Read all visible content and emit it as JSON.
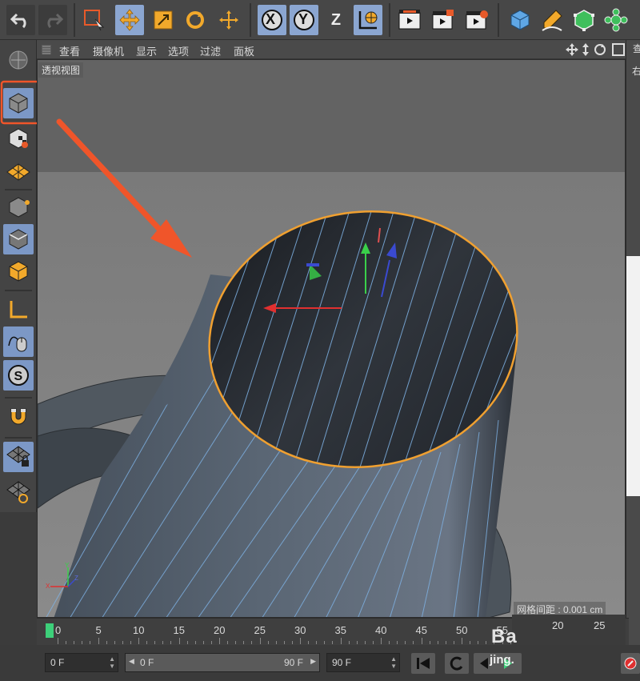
{
  "viewport_menu": [
    "查看",
    "摄像机",
    "显示",
    "选项",
    "过滤",
    "面板"
  ],
  "viewport_label": "透视视图",
  "grid_spacing": "网格间距 : 0.001 cm",
  "right_panel_tab": "查",
  "right_panel_tab_2": "右",
  "axis_buttons": {
    "x": "X",
    "y": "Y",
    "z": "Z"
  },
  "timeline": {
    "ticks": [
      "0",
      "5",
      "10",
      "15",
      "20",
      "25",
      "30",
      "35",
      "40",
      "45",
      "50",
      "55"
    ],
    "mini_ticks": [
      "20",
      "25"
    ],
    "current_frame": 0
  },
  "frame_fields": {
    "start": "0 F",
    "range_start": "0 F",
    "range_end": "90 F",
    "end": "90 F"
  },
  "watermark": {
    "brand": "Ba",
    "sub": "jing."
  },
  "colors": {
    "active_button": "#8ba6d1",
    "selection_outline": "#f0a030",
    "annotation_arrow": "#f0552a",
    "highlight_box": "#f0552a",
    "edge_lines": "#7fb3e6",
    "playhead": "#3dd07a"
  },
  "icons": {
    "undo": "undo-icon",
    "redo": "redo-icon",
    "select": "live-selection-icon",
    "move": "move-icon",
    "scale": "scale-icon",
    "rotate": "rotate-icon",
    "world": "world-coordinate-icon",
    "render": "render-view-icon"
  }
}
